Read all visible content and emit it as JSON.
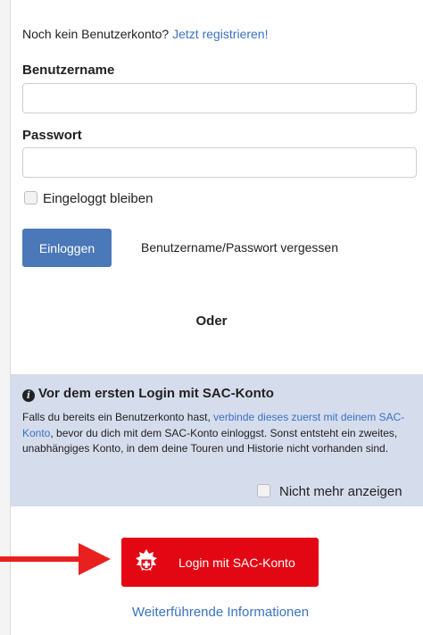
{
  "register": {
    "prompt": "Noch kein Benutzerkonto?",
    "link": "Jetzt registrieren!"
  },
  "form": {
    "username_label": "Benutzername",
    "username_value": "",
    "password_label": "Passwort",
    "password_value": "",
    "remember_label": "Eingeloggt bleiben",
    "login_button": "Einloggen",
    "forgot_link": "Benutzername/Passwort vergessen"
  },
  "separator": "Oder",
  "info": {
    "title": "Vor dem ersten Login mit SAC-Konto",
    "text_before": "Falls du bereits ein Benutzerkonto hast,",
    "link": "verbinde dieses zuerst mit deinem SAC-Konto",
    "text_after": ", bevor du dich mit dem SAC-Konto einloggst. Sonst entsteht ein zweites, unabhängiges Konto, in dem deine Touren und Historie nicht vorhanden sind.",
    "dont_show_label": "Nicht mehr anzeigen"
  },
  "sac": {
    "button_label": "Login mit SAC-Konto",
    "more_info_link": "Weiterführende Informationen"
  },
  "colors": {
    "accent_blue": "#4a78b8",
    "link_blue": "#3a73c1",
    "sac_red": "#e30613",
    "info_bg": "#d5dcec",
    "arrow_red": "#e8201f"
  },
  "icons": {
    "info": "info-circle-icon",
    "arrow": "red-arrow-icon",
    "emblem": "sac-emblem-icon"
  }
}
